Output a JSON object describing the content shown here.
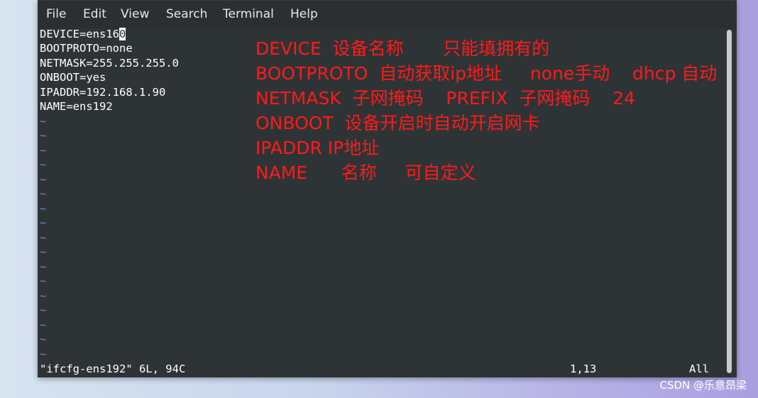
{
  "menubar": {
    "items": [
      "File",
      "Edit",
      "View",
      "Search",
      "Terminal",
      "Help"
    ]
  },
  "editor": {
    "line1_prefix": "DEVICE=ens16",
    "line1_cursor_char": "0",
    "lines": [
      "BOOTPROTO=none",
      "NETMASK=255.255.255.0",
      "ONBOOT=yes",
      "IPADDR=192.168.1.90",
      "NAME=ens192"
    ],
    "tilde": "~"
  },
  "annotations": [
    "DEVICE  设备名称       只能填拥有的",
    "BOOTPROTO  自动获取ip地址     none手动    dhcp 自动",
    "NETMASK  子网掩码    PREFIX  子网掩码    24",
    "ONBOOT  设备开启时自动开启网卡",
    "IPADDR IP地址",
    "NAME      名称     可自定义"
  ],
  "status": {
    "file_info": "\"ifcfg-ens192\" 6L, 94C",
    "position": "1,13",
    "scroll": "All"
  },
  "watermark": "CSDN @乐意昂梁",
  "colors": {
    "terminal_bg": "#2e3436",
    "annotation": "#ff1a1a",
    "tilde": "#5d8fc7"
  }
}
